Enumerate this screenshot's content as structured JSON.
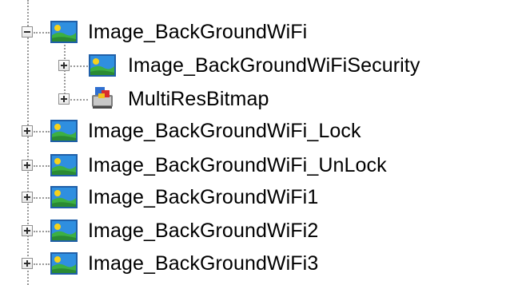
{
  "tree": {
    "root": {
      "label": "Image_BackGroundWiFi",
      "expanded": true,
      "icon": "image-picture-icon",
      "children": [
        {
          "label": "Image_BackGroundWiFiSecurity",
          "expanded": false,
          "icon": "image-picture-icon"
        },
        {
          "label": "MultiResBitmap",
          "expanded": false,
          "icon": "multires-bitmap-icon"
        }
      ]
    },
    "siblings": [
      {
        "label": "Image_BackGroundWiFi_Lock",
        "expanded": false,
        "icon": "image-picture-icon"
      },
      {
        "label": "Image_BackGroundWiFi_UnLock",
        "expanded": false,
        "icon": "image-picture-icon"
      },
      {
        "label": "Image_BackGroundWiFi1",
        "expanded": false,
        "icon": "image-picture-icon"
      },
      {
        "label": "Image_BackGroundWiFi2",
        "expanded": false,
        "icon": "image-picture-icon"
      },
      {
        "label": "Image_BackGroundWiFi3",
        "expanded": false,
        "icon": "image-picture-icon"
      }
    ]
  },
  "colors": {
    "connector": "#9a9a9a",
    "image_icon_sky": "#2f8fe0",
    "image_icon_land": "#3cb043",
    "image_icon_sun": "#f7d21b",
    "image_icon_frame": "#1f5fa8"
  }
}
